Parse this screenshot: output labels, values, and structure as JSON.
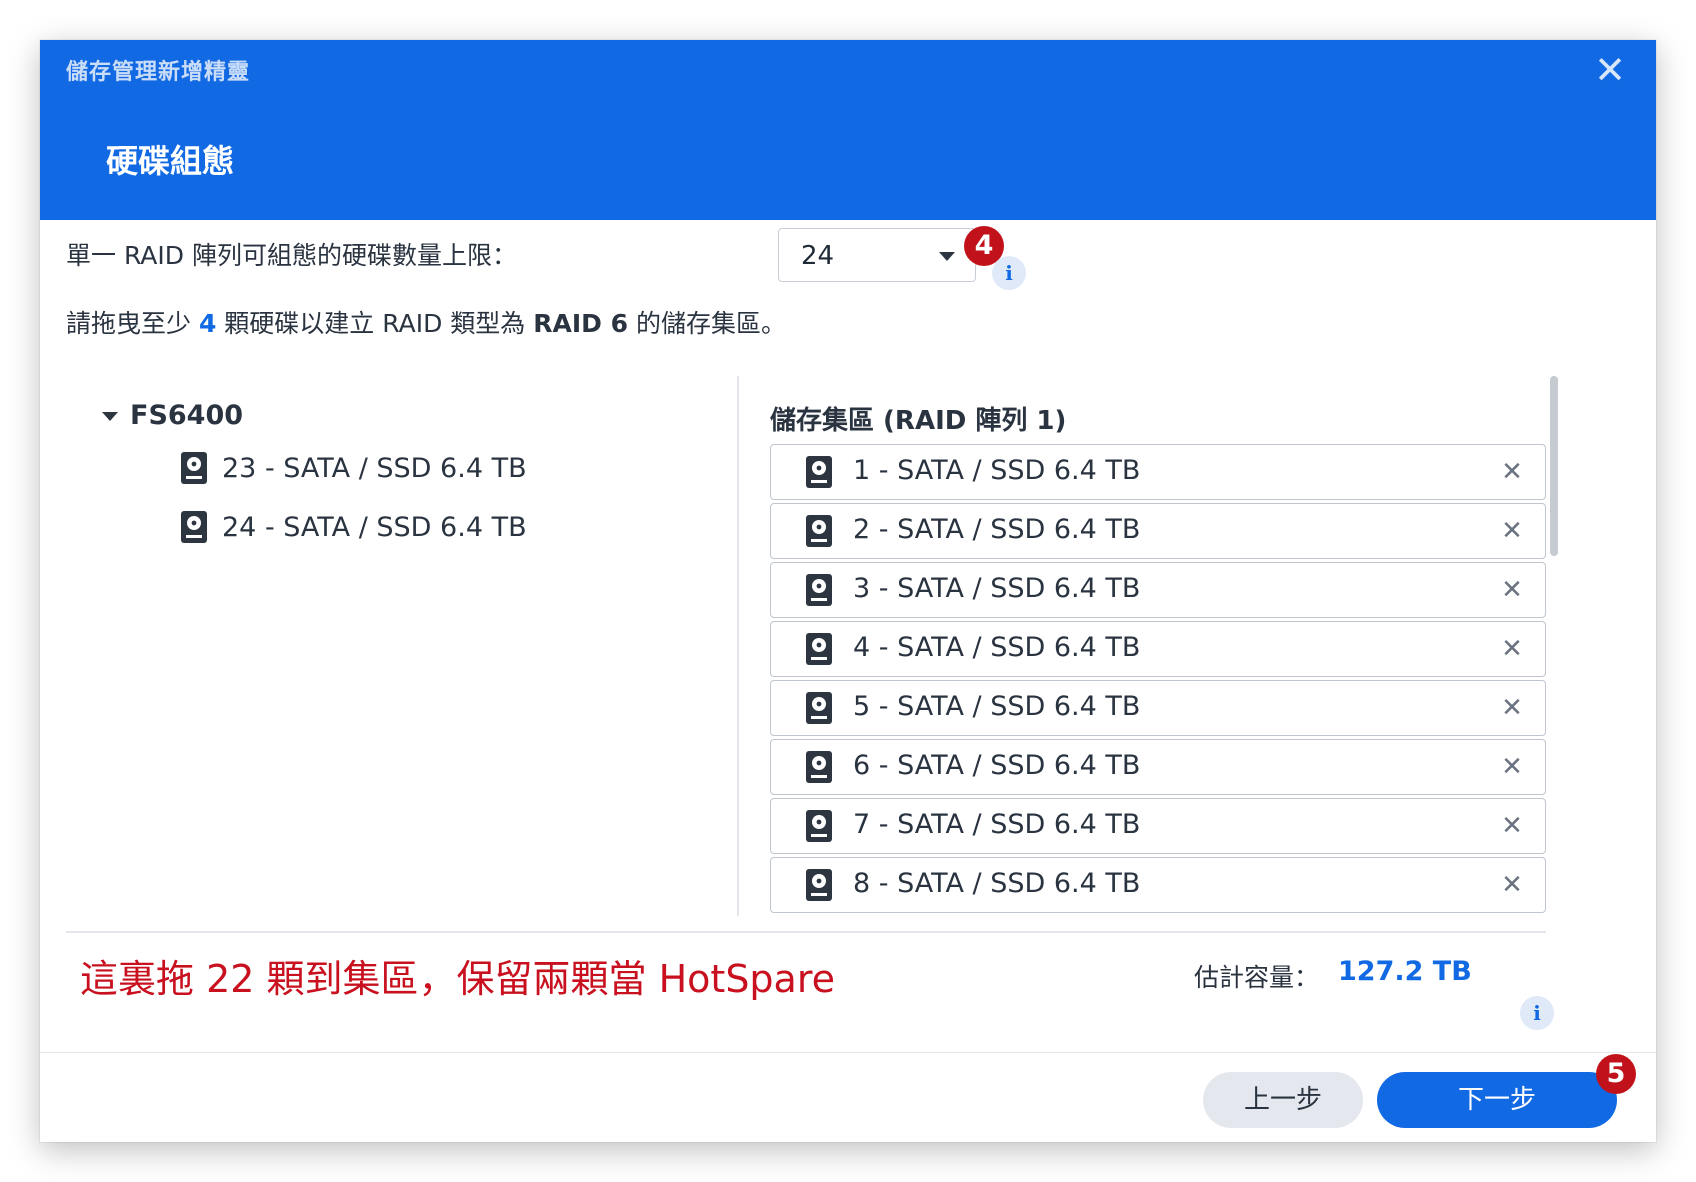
{
  "window": {
    "title": "儲存管理新增精靈",
    "close_glyph": "✕"
  },
  "step": {
    "title": "硬碟組態"
  },
  "limit": {
    "label": "單一 RAID 陣列可組態的硬碟數量上限：",
    "value": "24",
    "info_glyph": "i",
    "annotation_badge": "4"
  },
  "instruction": {
    "part1": "請拖曳至少 ",
    "min_disks": "4",
    "part2": " 顆硬碟以建立 RAID 類型為 ",
    "raid_type": "RAID 6",
    "part3": " 的儲存集區。"
  },
  "available": {
    "device": "FS6400",
    "disks": [
      "23 - SATA / SSD 6.4 TB",
      "24 - SATA / SSD 6.4 TB"
    ]
  },
  "pool": {
    "title": "儲存集區 (RAID 陣列 1)",
    "remove_glyph": "✕",
    "disks": [
      "1 - SATA / SSD 6.4 TB",
      "2 - SATA / SSD 6.4 TB",
      "3 - SATA / SSD 6.4 TB",
      "4 - SATA / SSD 6.4 TB",
      "5 - SATA / SSD 6.4 TB",
      "6 - SATA / SSD 6.4 TB",
      "7 - SATA / SSD 6.4 TB",
      "8 - SATA / SSD 6.4 TB"
    ]
  },
  "note": "這裏拖 22 顆到集區，保留兩顆當 HotSpare",
  "capacity": {
    "label": "估計容量：",
    "value": "127.2 TB",
    "info_glyph": "i"
  },
  "buttons": {
    "prev": "上一步",
    "next": "下一步",
    "next_badge": "5"
  },
  "colors": {
    "accent": "#1169e3",
    "annotation": "#c8101f",
    "badge": "#c1121c"
  },
  "icons": {
    "disk": "hard-disk-icon",
    "remove": "close-icon",
    "caret": "caret-down-icon"
  }
}
